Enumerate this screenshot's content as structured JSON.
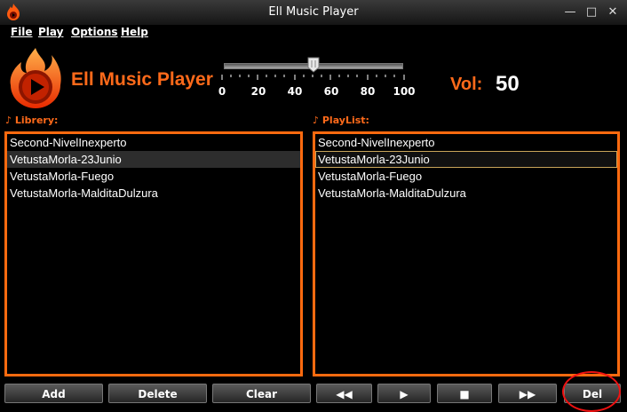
{
  "window": {
    "title": "Ell Music Player",
    "controls": {
      "minimize": "—",
      "maximize": "□",
      "close": "✕"
    }
  },
  "menu": {
    "items": [
      "File",
      "Play",
      "Options",
      "Help"
    ]
  },
  "header": {
    "app_name": "Ell Music Player",
    "volume_label": "Vol:",
    "volume_value": "50",
    "slider_ticks": [
      "0",
      "20",
      "40",
      "60",
      "80",
      "100"
    ],
    "slider_level_percent": 50
  },
  "library": {
    "label": "Librery:",
    "items": [
      "Second-NivelInexperto",
      "VetustaMorla-23Junio",
      "VetustaMorla-Fuego",
      "VetustaMorla-MalditaDulzura"
    ],
    "selected_index": 1
  },
  "playlist": {
    "label": "PlayList:",
    "items": [
      "Second-NivelInexperto",
      "VetustaMorla-23Junio",
      "VetustaMorla-Fuego",
      "VetustaMorla-MalditaDulzura"
    ],
    "selected_index": 1
  },
  "buttons": {
    "add": "Add",
    "delete": "Delete",
    "clear": "Clear",
    "prev": "◀◀",
    "play": "▶",
    "stop": "■",
    "next": "▶▶",
    "del": "Del"
  },
  "colors": {
    "accent": "#ff6a0f",
    "annotation_circle": "#e11111",
    "background": "#000000"
  },
  "icons": [
    "app-flame-icon",
    "logo-flame-play-icon",
    "music-note-icon"
  ]
}
